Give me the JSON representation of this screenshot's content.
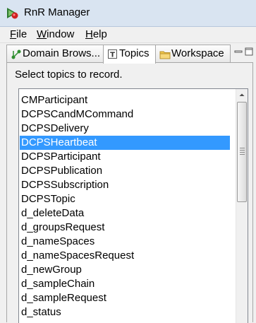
{
  "window": {
    "title": "RnR Manager",
    "app_icon": "rnr-manager-icon"
  },
  "menu": [
    {
      "mnemonic": "F",
      "rest": "ile"
    },
    {
      "mnemonic": "W",
      "rest": "indow"
    },
    {
      "mnemonic": "H",
      "rest": "elp"
    }
  ],
  "tabs": [
    {
      "label": "Domain Brows...",
      "icon": "domain-browser-icon",
      "active": false
    },
    {
      "label": "Topics",
      "icon": "topics-icon",
      "active": true
    },
    {
      "label": "Workspace",
      "icon": "workspace-folder-icon",
      "active": false
    }
  ],
  "panel": {
    "instructions": "Select topics to record.",
    "topics": [
      "CMParticipant",
      "DCPSCandMCommand",
      "DCPSDelivery",
      "DCPSHeartbeat",
      "DCPSParticipant",
      "DCPSPublication",
      "DCPSSubscription",
      "DCPSTopic",
      "d_deleteData",
      "d_groupsRequest",
      "d_nameSpaces",
      "d_nameSpacesRequest",
      "d_newGroup",
      "d_sampleChain",
      "d_sampleRequest",
      "d_status"
    ],
    "selected_topic": "DCPSHeartbeat"
  },
  "colors": {
    "selection": "#3399ff",
    "titlebar": "#d9e4f1"
  }
}
